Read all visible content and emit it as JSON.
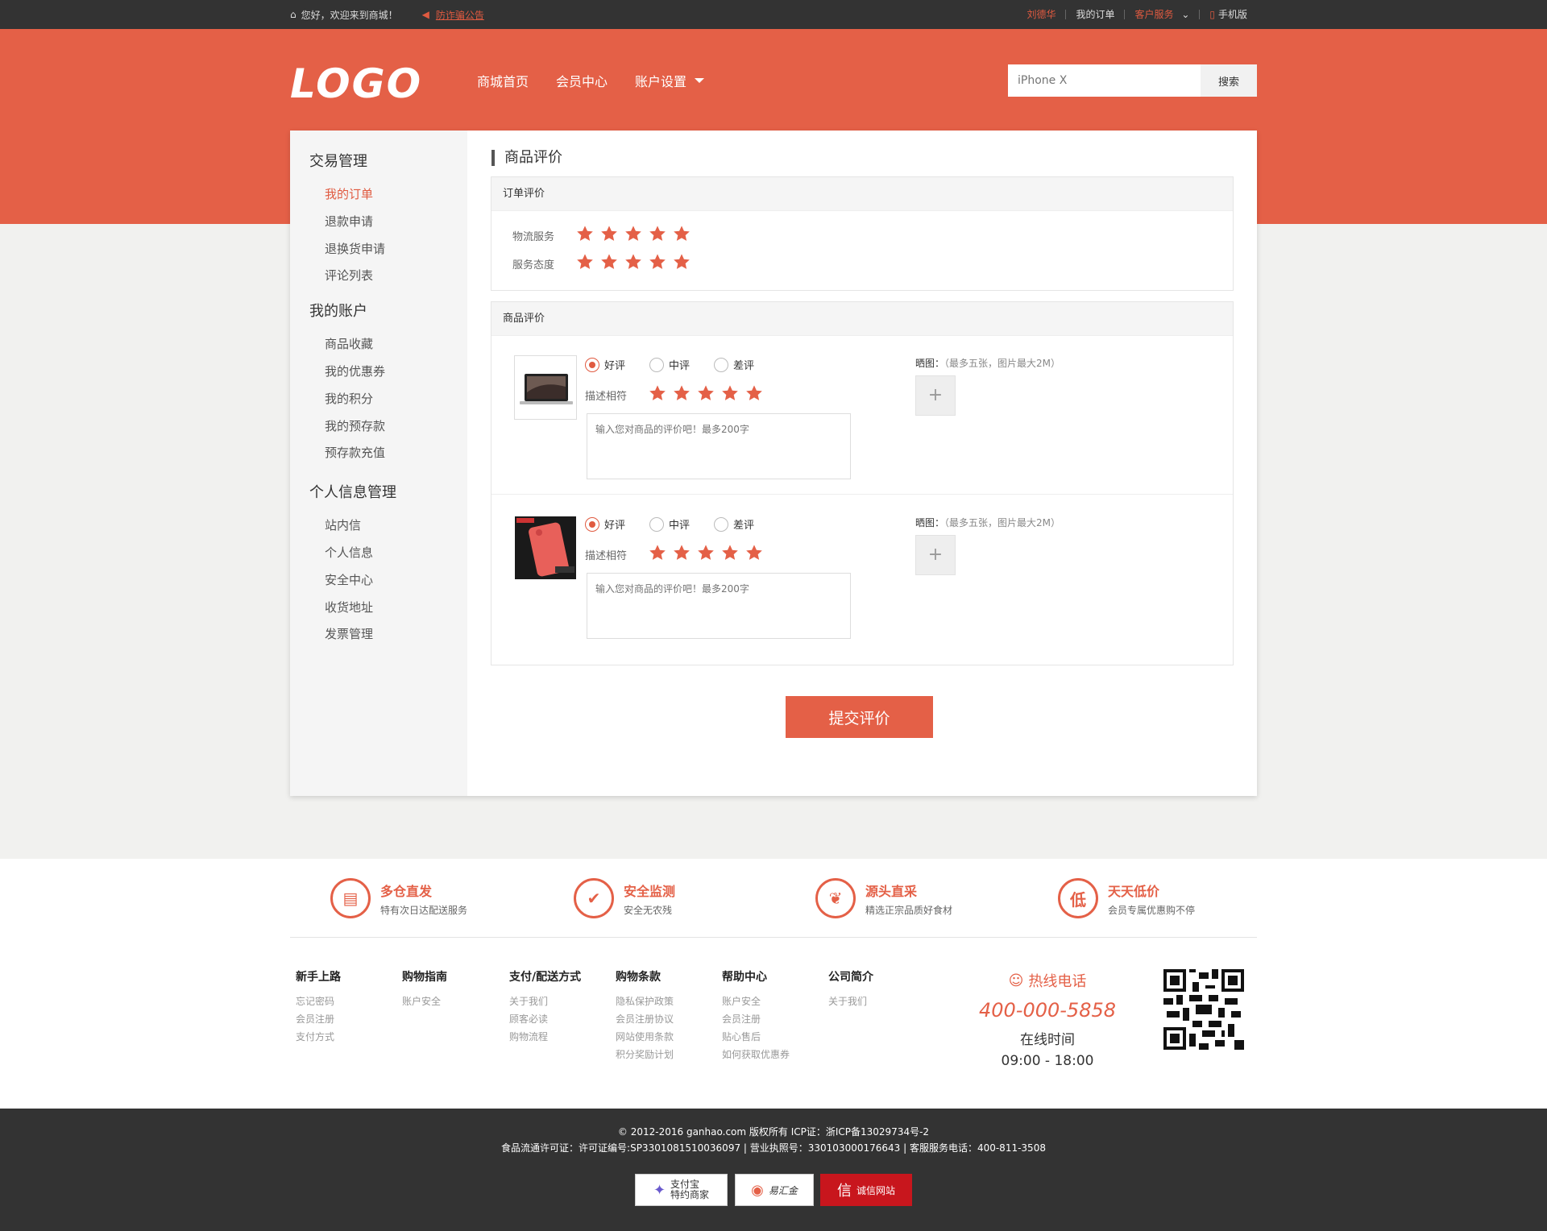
{
  "topbar": {
    "welcome": "您好，欢迎来到商城！",
    "notice": "防诈骗公告",
    "user": "刘德华",
    "my_orders": "我的订单",
    "customer_service": "客户服务",
    "mobile": "手机版"
  },
  "header": {
    "logo": "LOGO",
    "nav": [
      "商城首页",
      "会员中心",
      "账户设置"
    ],
    "search_placeholder": "iPhone X",
    "search_button": "搜索"
  },
  "sidebar": {
    "groups": [
      {
        "title": "交易管理",
        "items": [
          "我的订单",
          "退款申请",
          "退换货申请",
          "评论列表"
        ]
      },
      {
        "title": "我的账户",
        "items": [
          "商品收藏",
          "我的优惠券",
          "我的积分",
          "我的预存款",
          "预存款充值"
        ]
      },
      {
        "title": "个人信息管理",
        "items": [
          "站内信",
          "个人信息",
          "安全中心",
          "收货地址",
          "发票管理"
        ]
      }
    ]
  },
  "main": {
    "title": "商品评价",
    "order_review": {
      "header": "订单评价",
      "rows": [
        {
          "label": "物流服务",
          "stars": 5
        },
        {
          "label": "服务态度",
          "stars": 5
        }
      ]
    },
    "product_review": {
      "header": "商品评价",
      "ratings": [
        "好评",
        "中评",
        "差评"
      ],
      "desc_label": "描述相符",
      "placeholder": "输入您对商品的评价吧！最多200字",
      "photo_label": "晒图：",
      "photo_hint": "（最多五张，图片最大2M）",
      "items": [
        {
          "image": "laptop-image",
          "selected": "好评",
          "stars": 5
        },
        {
          "image": "phone-case-image",
          "selected": "好评",
          "stars": 5
        }
      ]
    },
    "submit": "提交评价"
  },
  "features": [
    {
      "title": "多仓直发",
      "desc": "特有次日达配送服务",
      "icon": "warehouse-icon"
    },
    {
      "title": "安全监测",
      "desc": "安全无农残",
      "icon": "shield-icon"
    },
    {
      "title": "源头直采",
      "desc": "精选正宗品质好食材",
      "icon": "vegetable-icon"
    },
    {
      "title": "天天低价",
      "desc": "会员专属优惠购不停",
      "icon": "low-price-icon"
    }
  ],
  "footer_links": [
    {
      "title": "新手上路",
      "links": [
        "忘记密码",
        "会员注册",
        "支付方式"
      ]
    },
    {
      "title": "购物指南",
      "links": [
        "账户安全"
      ]
    },
    {
      "title": "支付/配送方式",
      "links": [
        "关于我们",
        "顾客必读",
        "购物流程"
      ]
    },
    {
      "title": "购物条款",
      "links": [
        "隐私保护政策",
        "会员注册协议",
        "网站使用条款",
        "积分奖励计划"
      ]
    },
    {
      "title": "帮助中心",
      "links": [
        "账户安全",
        "会员注册",
        "贴心售后",
        "如何获取优惠券"
      ]
    },
    {
      "title": "公司简介",
      "links": [
        "关于我们"
      ]
    }
  ],
  "hotline": {
    "title": "热线电话",
    "number": "400-000-5858",
    "hours_label": "在线时间",
    "hours": "09:00 - 18:00"
  },
  "copyright": {
    "line1": "© 2012-2016 ganhao.com 版权所有 ICP证：浙ICP备13029734号-2",
    "line2": "食品流通许可证：许可证编号:SP3301081510036097 | 营业执照号：330103000176643 | 客服服务电话：400-811-3508"
  },
  "badges": [
    "支付宝\n特约商家",
    "易汇金",
    "诚信网站"
  ],
  "colors": {
    "accent": "#e46047",
    "dark": "#333333"
  }
}
